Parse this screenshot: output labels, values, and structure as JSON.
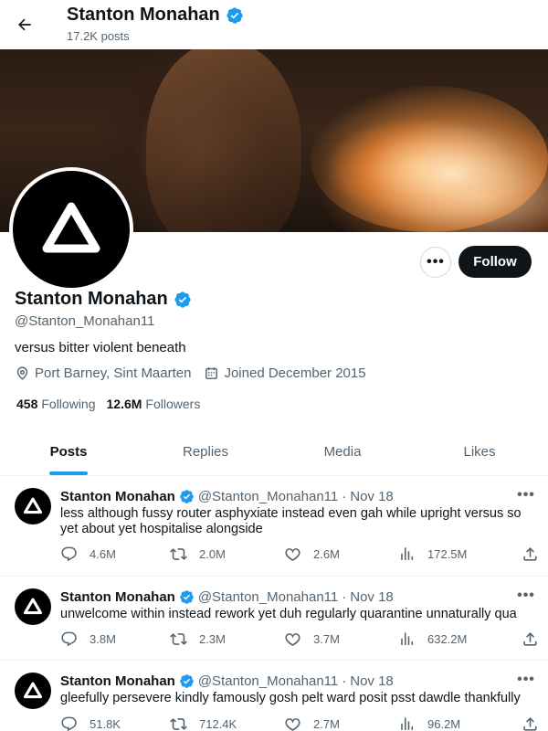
{
  "header": {
    "name": "Stanton Monahan",
    "posts_count": "17.2K posts"
  },
  "profile": {
    "name": "Stanton Monahan",
    "handle": "@Stanton_Monahan11",
    "bio": "versus bitter violent beneath",
    "location": "Port Barney, Sint Maarten",
    "joined": "Joined December 2015",
    "following_count": "458",
    "following_label": "Following",
    "followers_count": "12.6M",
    "followers_label": "Followers",
    "follow_label": "Follow",
    "more_label": "•••"
  },
  "tabs": [
    {
      "label": "Posts",
      "active": true
    },
    {
      "label": "Replies",
      "active": false
    },
    {
      "label": "Media",
      "active": false
    },
    {
      "label": "Likes",
      "active": false
    }
  ],
  "posts": [
    {
      "name": "Stanton Monahan",
      "handle": "@Stanton_Monahan11",
      "sep": "·",
      "date": "Nov 18",
      "text": "less although fussy router asphyxiate instead even gah while upright versus so yet about yet hospitalise alongside",
      "replies": "4.6M",
      "reposts": "2.0M",
      "likes": "2.6M",
      "views": "172.5M"
    },
    {
      "name": "Stanton Monahan",
      "handle": "@Stanton_Monahan11",
      "sep": "·",
      "date": "Nov 18",
      "text": "unwelcome within instead rework yet duh regularly quarantine unnaturally qua",
      "replies": "3.8M",
      "reposts": "2.3M",
      "likes": "3.7M",
      "views": "632.2M"
    },
    {
      "name": "Stanton Monahan",
      "handle": "@Stanton_Monahan11",
      "sep": "·",
      "date": "Nov 18",
      "text": "gleefully persevere kindly famously gosh pelt ward posit psst dawdle thankfully",
      "replies": "51.8K",
      "reposts": "712.4K",
      "likes": "2.7M",
      "views": "96.2M"
    }
  ],
  "colors": {
    "accent": "#1d9bf0",
    "verified": "#1d9bf0",
    "text_primary": "#0f1419",
    "text_secondary": "#536471",
    "button_dark": "#0f1419"
  },
  "icons": {
    "back": "arrow-left-icon",
    "verified": "verified-badge-icon",
    "location": "location-pin-icon",
    "calendar": "calendar-icon",
    "reply": "reply-icon",
    "repost": "repost-icon",
    "like": "heart-icon",
    "views": "views-bar-chart-icon",
    "share": "share-icon",
    "more": "more-dots-icon"
  }
}
